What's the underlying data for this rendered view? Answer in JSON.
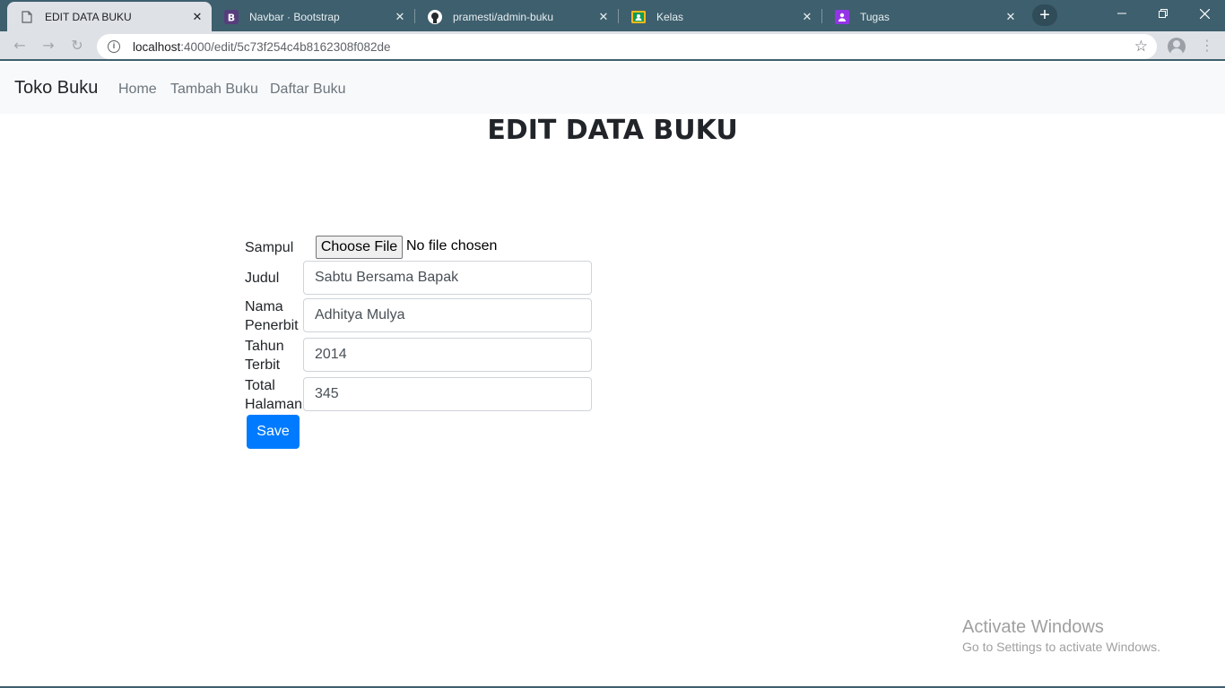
{
  "browser": {
    "tabs": [
      {
        "title": "EDIT DATA BUKU",
        "icon": "page-icon",
        "active": true
      },
      {
        "title": "Navbar · Bootstrap",
        "icon": "bootstrap-icon",
        "active": false
      },
      {
        "title": "pramesti/admin-buku",
        "icon": "github-icon",
        "active": false
      },
      {
        "title": "Kelas",
        "icon": "classroom-icon",
        "active": false
      },
      {
        "title": "Tugas",
        "icon": "assignment-icon",
        "active": false
      }
    ],
    "url_host": "localhost",
    "url_path": ":4000/edit/5c73f254c4b8162308f082de"
  },
  "navbar": {
    "brand": "Toko Buku",
    "links": [
      "Home",
      "Tambah Buku",
      "Daftar Buku"
    ]
  },
  "page": {
    "title": "EDIT DATA BUKU"
  },
  "form": {
    "sampul_label": "Sampul",
    "file_button": "Choose File",
    "file_status": "No file chosen",
    "judul_label": "Judul",
    "judul_value": "Sabtu Bersama Bapak",
    "penerbit_label_1": "Nama",
    "penerbit_label_2": "Penerbit",
    "penerbit_value": "Adhitya Mulya",
    "tahun_label_1": "Tahun",
    "tahun_label_2": "Terbit",
    "tahun_value": "2014",
    "halaman_label_1": "Total",
    "halaman_label_2": "Halaman",
    "halaman_value": "345",
    "save_label": "Save"
  },
  "watermark": {
    "title": "Activate Windows",
    "subtitle": "Go to Settings to activate Windows."
  },
  "colors": {
    "tabstrip": "#3e5f6d",
    "primary": "#007bff",
    "navbar_bg": "#f8f9fa"
  }
}
